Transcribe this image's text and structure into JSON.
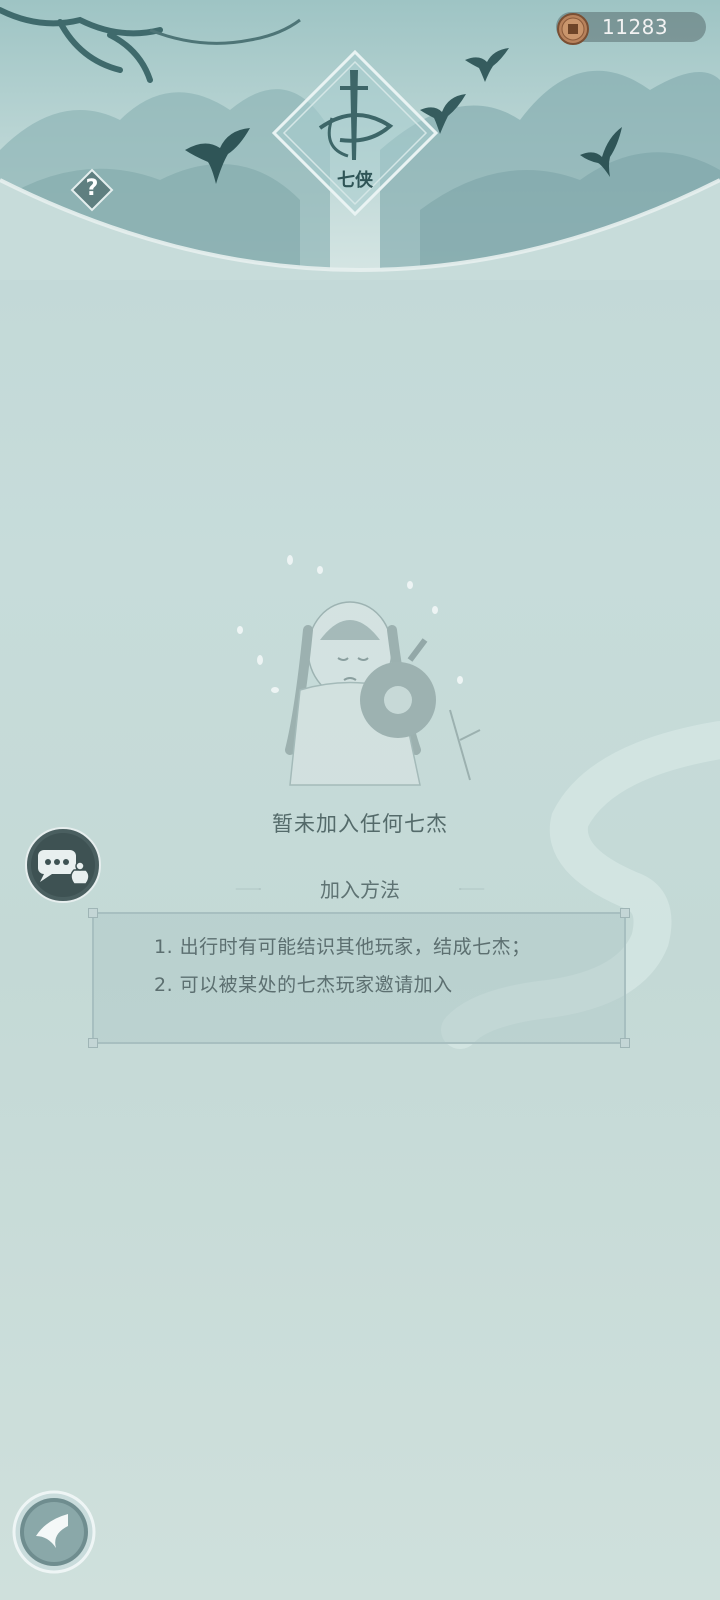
{
  "currency": {
    "amount": "11283",
    "icon": "copper-coin-icon"
  },
  "emblem": {
    "title": "七侠"
  },
  "help": {
    "icon": "question-mark-icon",
    "label": "?"
  },
  "empty_state": {
    "text": "暂未加入任何七杰"
  },
  "join_section": {
    "title": "加入方法",
    "lines": [
      "1. 出行时有可能结识其他玩家，结成七杰；",
      "2. 可以被某处的七杰玩家邀请加入"
    ]
  },
  "chat": {
    "icon": "chat-bubble-icon"
  },
  "back": {
    "icon": "back-arrow-icon"
  }
}
